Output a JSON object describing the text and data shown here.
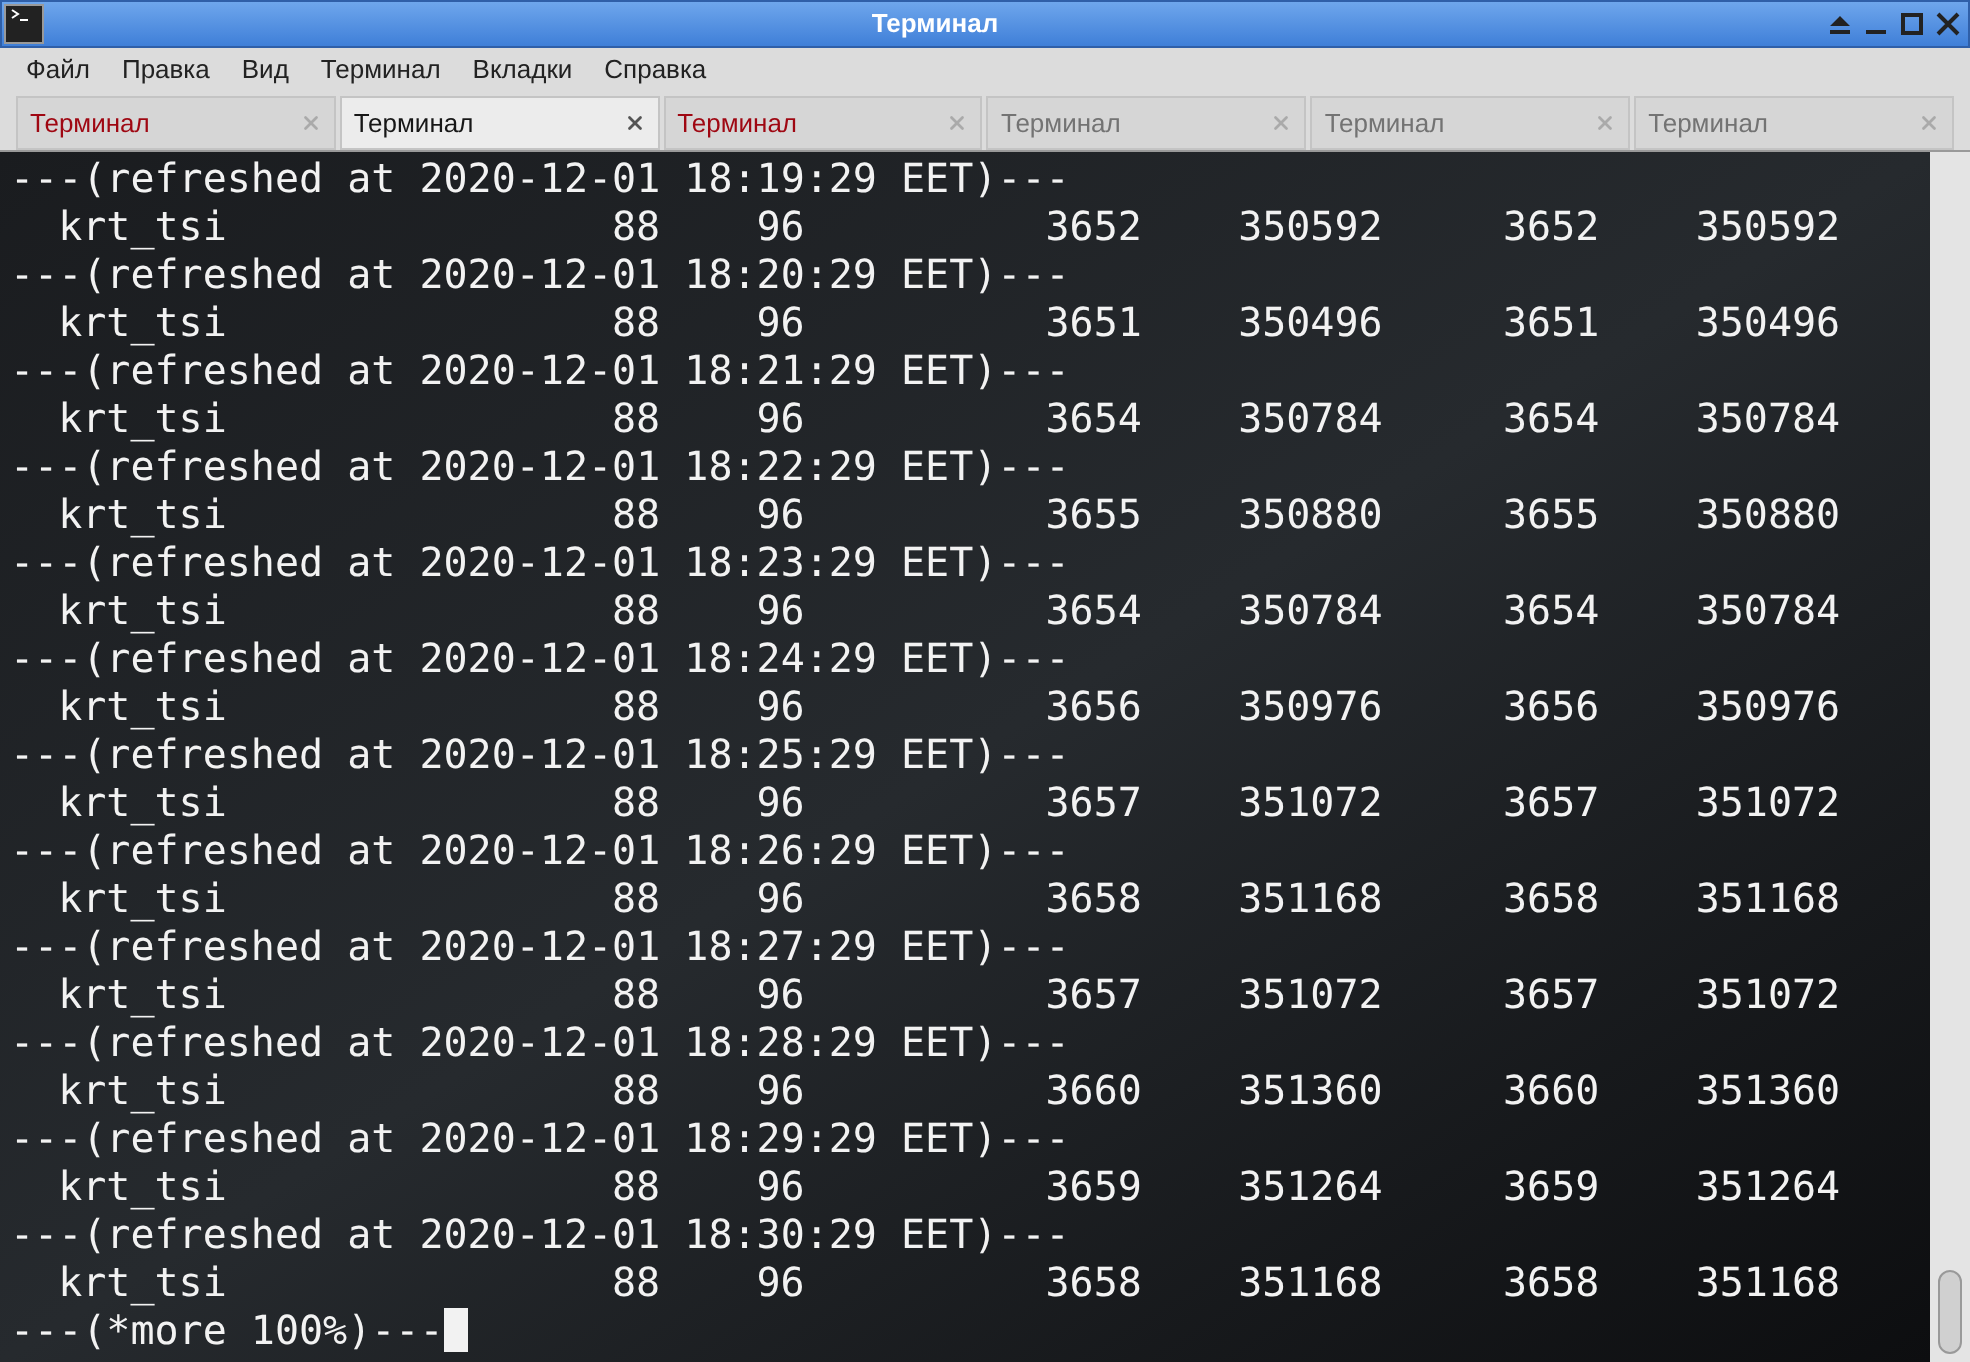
{
  "window": {
    "title": "Терминал"
  },
  "menu": [
    "Файл",
    "Правка",
    "Вид",
    "Терминал",
    "Вкладки",
    "Справка"
  ],
  "tabs": [
    {
      "label": "Терминал",
      "selected": false,
      "activity": true
    },
    {
      "label": "Терминал",
      "selected": true,
      "activity": false
    },
    {
      "label": "Терминал",
      "selected": false,
      "activity": true
    },
    {
      "label": "Терминал",
      "selected": false,
      "activity": false
    },
    {
      "label": "Терминал",
      "selected": false,
      "activity": false
    },
    {
      "label": "Терминал",
      "selected": false,
      "activity": false
    }
  ],
  "terminal": {
    "blocks": [
      {
        "header": "---(refreshed at 2020-12-01 18:19:29 EET)---",
        "row": [
          "krt_tsi",
          "88",
          "96",
          "3652",
          "350592",
          "3652",
          "350592"
        ]
      },
      {
        "header": "---(refreshed at 2020-12-01 18:20:29 EET)---",
        "row": [
          "krt_tsi",
          "88",
          "96",
          "3651",
          "350496",
          "3651",
          "350496"
        ]
      },
      {
        "header": "---(refreshed at 2020-12-01 18:21:29 EET)---",
        "row": [
          "krt_tsi",
          "88",
          "96",
          "3654",
          "350784",
          "3654",
          "350784"
        ]
      },
      {
        "header": "---(refreshed at 2020-12-01 18:22:29 EET)---",
        "row": [
          "krt_tsi",
          "88",
          "96",
          "3655",
          "350880",
          "3655",
          "350880"
        ]
      },
      {
        "header": "---(refreshed at 2020-12-01 18:23:29 EET)---",
        "row": [
          "krt_tsi",
          "88",
          "96",
          "3654",
          "350784",
          "3654",
          "350784"
        ]
      },
      {
        "header": "---(refreshed at 2020-12-01 18:24:29 EET)---",
        "row": [
          "krt_tsi",
          "88",
          "96",
          "3656",
          "350976",
          "3656",
          "350976"
        ]
      },
      {
        "header": "---(refreshed at 2020-12-01 18:25:29 EET)---",
        "row": [
          "krt_tsi",
          "88",
          "96",
          "3657",
          "351072",
          "3657",
          "351072"
        ]
      },
      {
        "header": "---(refreshed at 2020-12-01 18:26:29 EET)---",
        "row": [
          "krt_tsi",
          "88",
          "96",
          "3658",
          "351168",
          "3658",
          "351168"
        ]
      },
      {
        "header": "---(refreshed at 2020-12-01 18:27:29 EET)---",
        "row": [
          "krt_tsi",
          "88",
          "96",
          "3657",
          "351072",
          "3657",
          "351072"
        ]
      },
      {
        "header": "---(refreshed at 2020-12-01 18:28:29 EET)---",
        "row": [
          "krt_tsi",
          "88",
          "96",
          "3660",
          "351360",
          "3660",
          "351360"
        ]
      },
      {
        "header": "---(refreshed at 2020-12-01 18:29:29 EET)---",
        "row": [
          "krt_tsi",
          "88",
          "96",
          "3659",
          "351264",
          "3659",
          "351264"
        ]
      },
      {
        "header": "---(refreshed at 2020-12-01 18:30:29 EET)---",
        "row": [
          "krt_tsi",
          "88",
          "96",
          "3658",
          "351168",
          "3658",
          "351168"
        ]
      }
    ],
    "prompt": "---(*more 100%)---"
  }
}
